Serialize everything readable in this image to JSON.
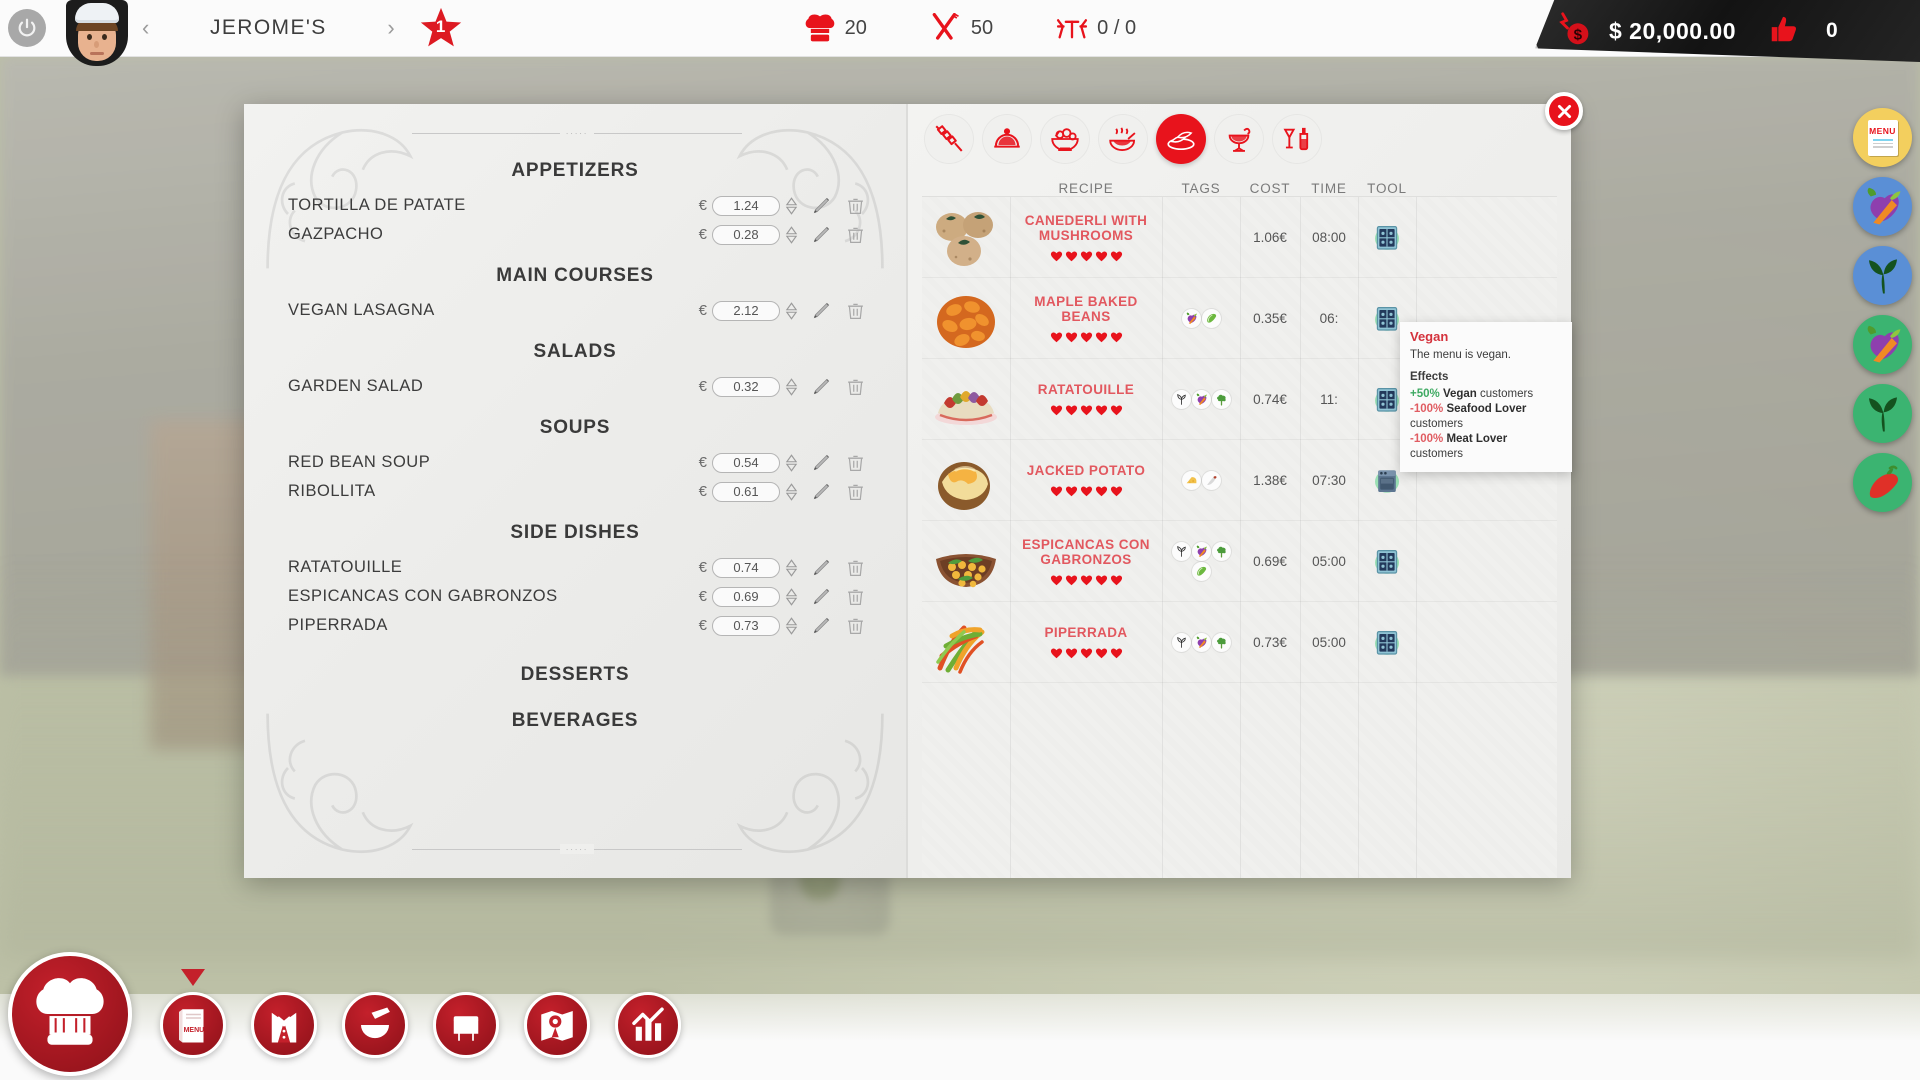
{
  "topbar": {
    "power_label": "power",
    "prev_label": "‹",
    "next_label": "›",
    "restaurant_name": "JEROME'S",
    "star_rating": "1",
    "stats": [
      {
        "icon": "chef-hat-icon",
        "name": "chef-skill",
        "value": "20"
      },
      {
        "icon": "cutlery-icon",
        "name": "service",
        "value": "50"
      },
      {
        "icon": "table-chairs-icon",
        "name": "tables",
        "value": "0 / 0"
      }
    ],
    "money": "$ 20,000.00",
    "reputation": "0"
  },
  "menu_page": {
    "decor_dots": "∙∙∙∙∙",
    "sections": [
      {
        "heading": "APPETIZERS",
        "dishes": [
          {
            "name": "TORTILLA DE PATATE",
            "currency": "€",
            "price": "1.24"
          },
          {
            "name": "GAZPACHO",
            "currency": "€",
            "price": "0.28"
          }
        ]
      },
      {
        "heading": "MAIN COURSES",
        "dishes": [
          {
            "name": "VEGAN LASAGNA",
            "currency": "€",
            "price": "2.12"
          }
        ]
      },
      {
        "heading": "SALADS",
        "dishes": [
          {
            "name": "GARDEN SALAD",
            "currency": "€",
            "price": "0.32"
          }
        ]
      },
      {
        "heading": "SOUPS",
        "dishes": [
          {
            "name": "RED BEAN SOUP",
            "currency": "€",
            "price": "0.54"
          },
          {
            "name": "RIBOLLITA",
            "currency": "€",
            "price": "0.61"
          }
        ]
      },
      {
        "heading": "SIDE DISHES",
        "dishes": [
          {
            "name": "RATATOUILLE",
            "currency": "€",
            "price": "0.74"
          },
          {
            "name": "ESPICANCAS CON GABRONZOS",
            "currency": "€",
            "price": "0.69"
          },
          {
            "name": "PIPERRADA",
            "currency": "€",
            "price": "0.73"
          }
        ]
      },
      {
        "heading": "DESSERTS",
        "dishes": []
      },
      {
        "heading": "BEVERAGES",
        "dishes": []
      }
    ]
  },
  "recipe_panel": {
    "close_label": "✕",
    "category_tabs": [
      {
        "name": "tab-appetizers",
        "icon": "skewer-icon",
        "active": false
      },
      {
        "name": "tab-main-courses",
        "icon": "cloche-icon",
        "active": false
      },
      {
        "name": "tab-salads",
        "icon": "salad-bowl-icon",
        "active": false
      },
      {
        "name": "tab-soups",
        "icon": "soup-bowl-icon",
        "active": false
      },
      {
        "name": "tab-side-dishes",
        "icon": "side-dish-icon",
        "active": true
      },
      {
        "name": "tab-desserts",
        "icon": "ice-cream-icon",
        "active": false
      },
      {
        "name": "tab-beverages",
        "icon": "drinks-icon",
        "active": false
      }
    ],
    "columns": [
      "RECIPE",
      "TAGS",
      "COST",
      "TIME",
      "TOOL"
    ],
    "recipes": [
      {
        "name": "CANEDERLI WITH MUSHROOMS",
        "thumb": "canederli-dumplings-image",
        "hearts": 5,
        "tags": [],
        "cost": "1.06€",
        "time": "08:00",
        "tool": "stove-icon"
      },
      {
        "name": "MAPLE BAKED BEANS",
        "thumb": "baked-beans-image",
        "hearts": 5,
        "tags": [
          "vegetables-icon",
          "cucumber-icon"
        ],
        "cost": "0.35€",
        "time": "06:",
        "tool": "stove-icon"
      },
      {
        "name": "RATATOUILLE",
        "thumb": "ratatouille-image",
        "hearts": 5,
        "tags": [
          "vegan-sprout-icon",
          "vegetables-icon",
          "broccoli-icon"
        ],
        "cost": "0.74€",
        "time": "11:",
        "tool": "stove-icon"
      },
      {
        "name": "JACKED POTATO",
        "thumb": "jacked-potato-image",
        "hearts": 5,
        "tags": [
          "cheese-icon",
          "spice-icon"
        ],
        "cost": "1.38€",
        "time": "07:30",
        "tool": "oven-icon"
      },
      {
        "name": "ESPICANCAS CON GABRONZOS",
        "thumb": "chickpeas-image",
        "hearts": 5,
        "tags": [
          "vegan-sprout-icon",
          "vegetables-icon",
          "broccoli-icon",
          "cucumber-icon"
        ],
        "cost": "0.69€",
        "time": "05:00",
        "tool": "stove-icon"
      },
      {
        "name": "PIPERRADA",
        "thumb": "piperrada-peppers-image",
        "hearts": 5,
        "tags": [
          "vegan-sprout-icon",
          "vegetables-icon",
          "broccoli-icon"
        ],
        "cost": "0.73€",
        "time": "05:00",
        "tool": "stove-icon"
      }
    ]
  },
  "tooltip": {
    "title": "Vegan",
    "description": "The menu is vegan.",
    "effects_heading": "Effects",
    "effects": [
      {
        "value": "+50%",
        "sign": "pos",
        "subject": "Vegan",
        "suffix": "customers"
      },
      {
        "value": "-100%",
        "sign": "neg",
        "subject": "Seafood Lover",
        "suffix": "customers"
      },
      {
        "value": "-100%",
        "sign": "neg",
        "subject": "Meat Lover",
        "suffix": "customers"
      }
    ]
  },
  "side_badges": [
    {
      "name": "badge-menu",
      "icon": "menu-card-icon",
      "color": "menu",
      "label": "MENU"
    },
    {
      "name": "badge-vegetarian-blue",
      "icon": "vegetables-icon",
      "color": "blue"
    },
    {
      "name": "badge-vegan-blue",
      "icon": "sprout-icon",
      "color": "blue"
    },
    {
      "name": "badge-vegetarian-green",
      "icon": "vegetables-icon",
      "color": "green"
    },
    {
      "name": "badge-vegan-green",
      "icon": "sprout-icon",
      "color": "green"
    },
    {
      "name": "badge-spicy-green",
      "icon": "chili-pepper-icon",
      "color": "green"
    }
  ],
  "bottom_toolbar": {
    "main_button": {
      "name": "chef-main-button",
      "icon": "chef-hat-icon"
    },
    "buttons": [
      {
        "name": "tool-menu",
        "icon": "menu-book-icon",
        "selected": true
      },
      {
        "name": "tool-staff",
        "icon": "bowtie-waiter-icon",
        "selected": false
      },
      {
        "name": "tool-kitchen",
        "icon": "mortar-pestle-icon",
        "selected": false
      },
      {
        "name": "tool-furniture",
        "icon": "furniture-icon",
        "selected": false
      },
      {
        "name": "tool-map",
        "icon": "map-pin-icon",
        "selected": false
      },
      {
        "name": "tool-statistics",
        "icon": "chart-icon",
        "selected": false
      }
    ]
  },
  "colors": {
    "accent_red": "#e8131c",
    "recipe_name": "#e2585f",
    "badge_yellow": "#f3cf5e",
    "badge_blue": "#5a8fd6",
    "badge_green": "#3bb471"
  }
}
